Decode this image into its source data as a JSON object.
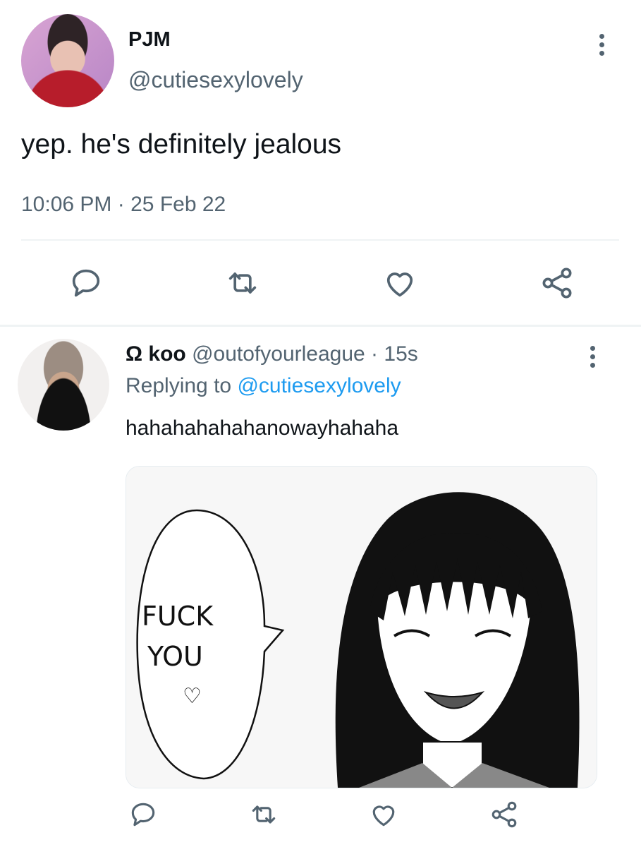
{
  "tweet": {
    "author_name": "PJM",
    "author_handle": "@cutiesexylovely",
    "text": "yep. he's definitely jealous",
    "time": "10:06 PM",
    "separator": "·",
    "date": "25 Feb 22",
    "actions": [
      "reply-icon",
      "retweet-icon",
      "like-icon",
      "share-icon"
    ]
  },
  "reply": {
    "author_name": "Ω koo",
    "author_handle": "@outofyourleague",
    "separator": "·",
    "time_ago": "15s",
    "replying_label": "Replying to",
    "replying_handle": "@cutiesexylovely",
    "text": "hahahahahahanowayhahaha",
    "media": {
      "speech_line1": "FUCK",
      "speech_line2": "YOU",
      "heart": "♡"
    },
    "actions": [
      "reply-icon",
      "retweet-icon",
      "like-icon",
      "share-icon"
    ]
  },
  "colors": {
    "text": "#0f1419",
    "muted": "#536471",
    "link": "#1d9bf0",
    "divider": "#eff3f4"
  }
}
